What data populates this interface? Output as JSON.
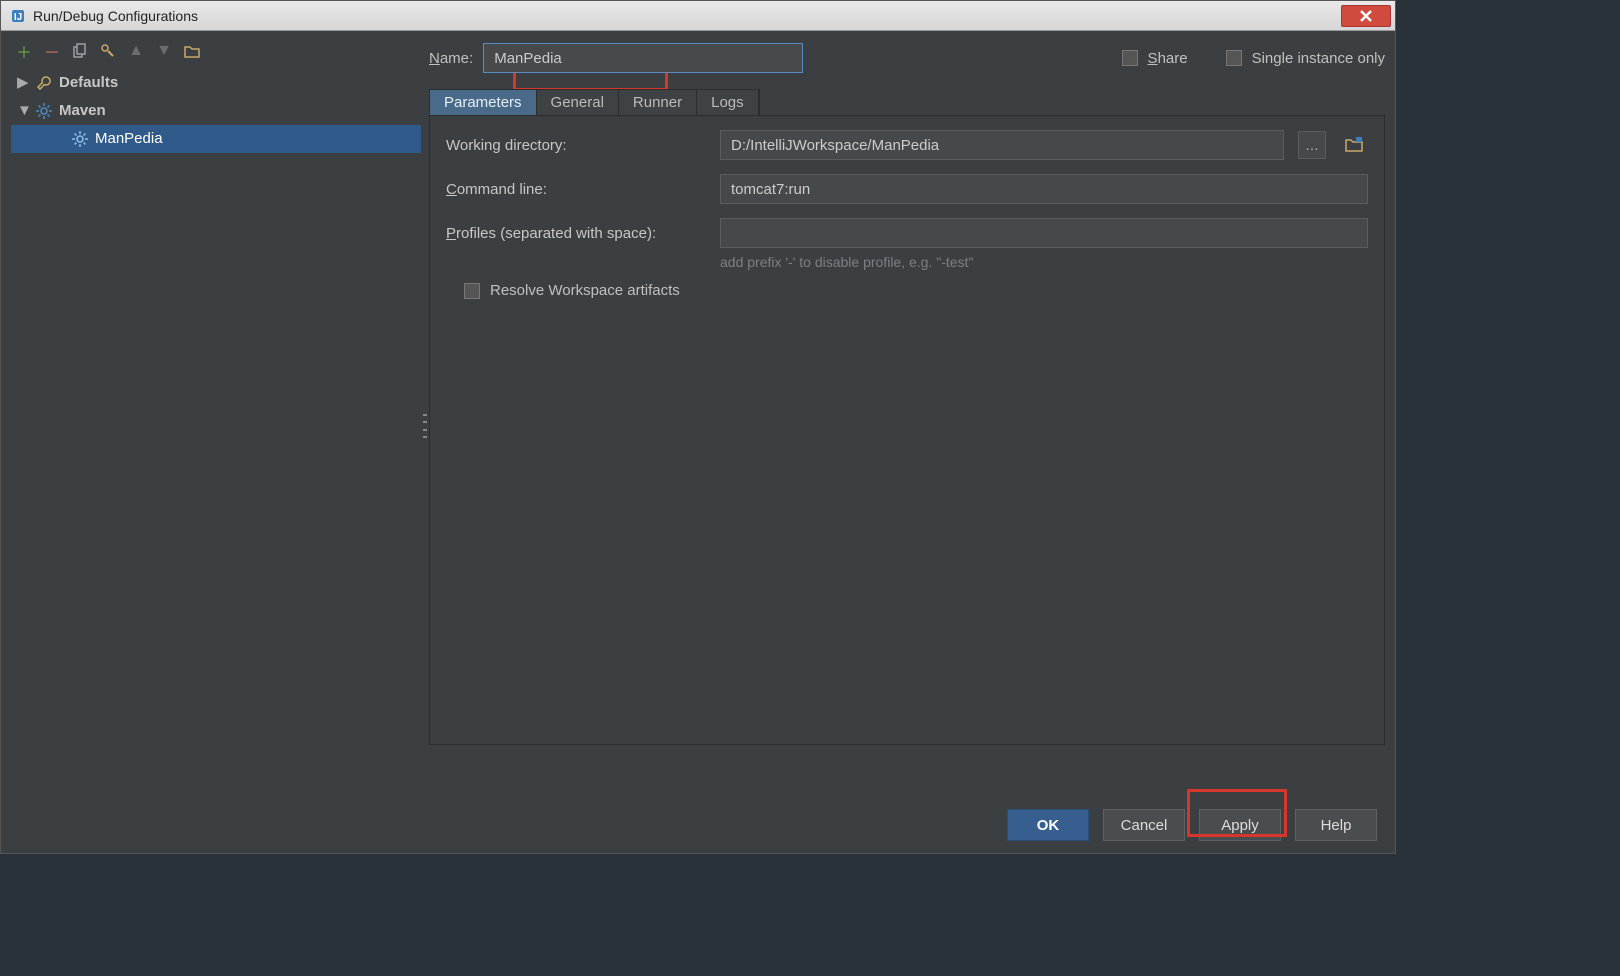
{
  "window": {
    "title": "Run/Debug Configurations"
  },
  "toolbar_icons": [
    "add",
    "remove",
    "copy",
    "edit",
    "up",
    "down",
    "folder"
  ],
  "tree": {
    "defaults_label": "Defaults",
    "maven_label": "Maven",
    "items": [
      {
        "label": "ManPedia"
      }
    ]
  },
  "name": {
    "label": "Name:",
    "value": "ManPedia"
  },
  "share": {
    "label": "Share"
  },
  "single_instance": {
    "label": "Single instance only"
  },
  "tabs": [
    "Parameters",
    "General",
    "Runner",
    "Logs"
  ],
  "parameters": {
    "working_dir": {
      "label": "Working directory:",
      "value": "D:/IntelliJWorkspace/ManPedia"
    },
    "command_line": {
      "label": "Command line:",
      "value": "tomcat7:run"
    },
    "profiles": {
      "label": "Profiles (separated with space):",
      "value": "",
      "hint": "add prefix '-' to disable profile, e.g. \"-test\""
    },
    "resolve_ws": {
      "label": "Resolve Workspace artifacts"
    }
  },
  "buttons": {
    "ok": "OK",
    "cancel": "Cancel",
    "apply": "Apply",
    "help": "Help"
  }
}
